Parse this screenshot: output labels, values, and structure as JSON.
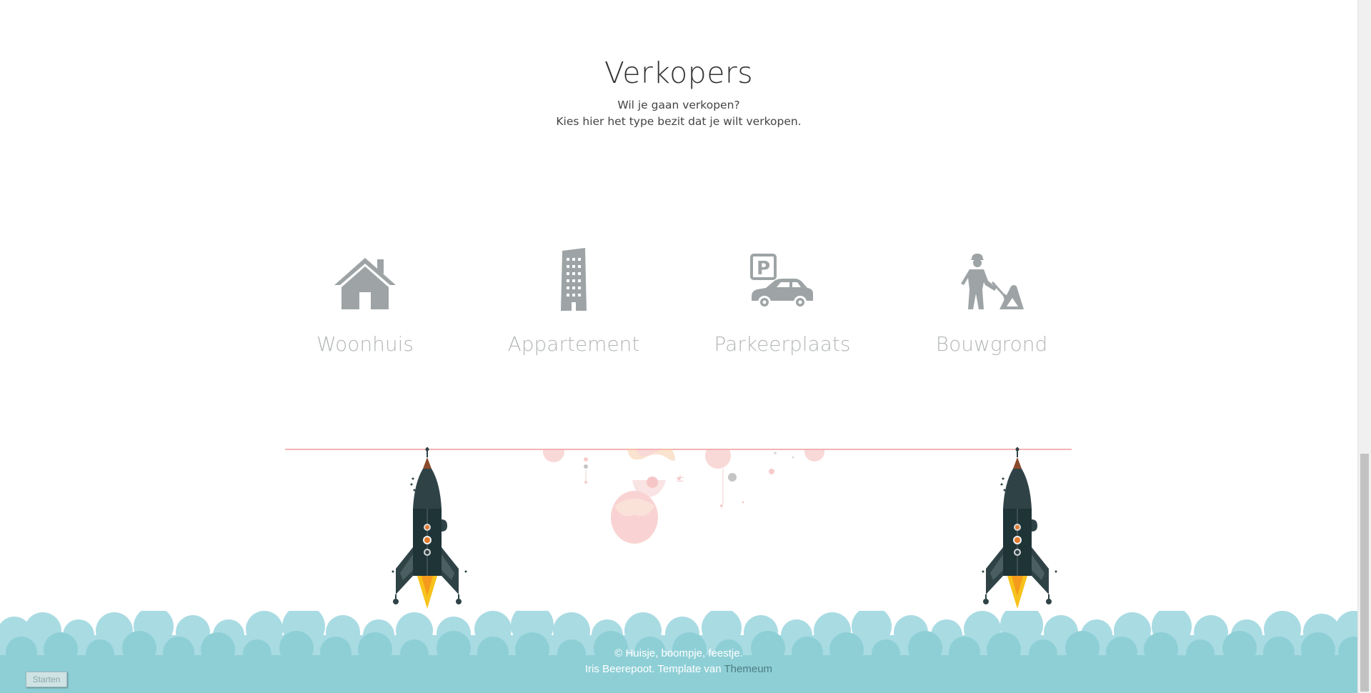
{
  "section": {
    "title": "Verkopers",
    "subtitle_line1": "Wil je gaan verkopen?",
    "subtitle_line2": "Kies hier het type bezit dat je wilt verkopen."
  },
  "categories": [
    {
      "label": "Woonhuis",
      "icon": "house-icon"
    },
    {
      "label": "Appartement",
      "icon": "apartment-building-icon"
    },
    {
      "label": "Parkeerplaats",
      "icon": "parking-car-icon"
    },
    {
      "label": "Bouwgrond",
      "icon": "construction-worker-icon"
    }
  ],
  "footer": {
    "copyright": "© Huisje, boompje, feestje.",
    "credit_prefix": "Iris Beerepoot. Template van",
    "credit_link": "Themeum"
  },
  "start_button": {
    "label": "Starten"
  },
  "colors": {
    "icon_gray": "#9ea4a5",
    "label_gray": "#b3b6b7",
    "cloud_light": "#a9dbe3",
    "cloud_dark": "#8ecfd6",
    "rope": "#f3b4b4",
    "rocket_body": "#2f4347",
    "flame": "#f7c21b"
  }
}
